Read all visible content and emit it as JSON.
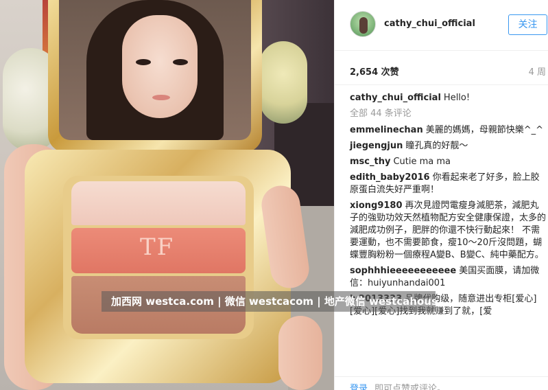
{
  "photo": {
    "alt_icon": "photo-of-makeup-compact",
    "logo_text": "TF"
  },
  "header": {
    "username": "cathy_chui_official",
    "follow_label": "关注"
  },
  "stats": {
    "likes": "2,654 次赞",
    "age": "4 周"
  },
  "caption": {
    "username": "cathy_chui_official",
    "text": "Hello!"
  },
  "all_comments_label": "全部 44 条评论",
  "comments": [
    {
      "username": "emmelinechan",
      "text": "美麗的媽媽，母親節快樂^_^"
    },
    {
      "username": "jiegengjun",
      "text": "瞳孔真的好靓～"
    },
    {
      "username": "msc_thy",
      "text": "Cutie ma ma"
    },
    {
      "username": "edith_baby2016",
      "text": "你看起来老了好多，脸上胶原蛋白流失好严重啊！"
    },
    {
      "username": "xiong9180",
      "text": "再次見證閃電瘦身減肥茶，減肥丸子的強勁功效天然植物配方安全健康保證，太多的減肥成功例子，肥胖的你還不快行動起來！ 不需要運動，也不需要節食，瘦10～20斤沒問題，蝴蝶豐胸粉粉一個療程A變B、B變C、純中藥配方。"
    },
    {
      "username": "sophhhieeeeeeeeeee",
      "text": "美国买面膜，请加微信：huiyunhandai001"
    },
    {
      "username": "lv2013333",
      "text": "品牌代购级，随意进出专柜[爱心][爱心][爱心]找到我就赚到了就，[爱"
    }
  ],
  "footer": {
    "login_label": "登录",
    "hint": "即可点赞或评论。"
  },
  "watermark": "加西网 westca.com | 微信 westcacom | 地产微信 westcahouse"
}
